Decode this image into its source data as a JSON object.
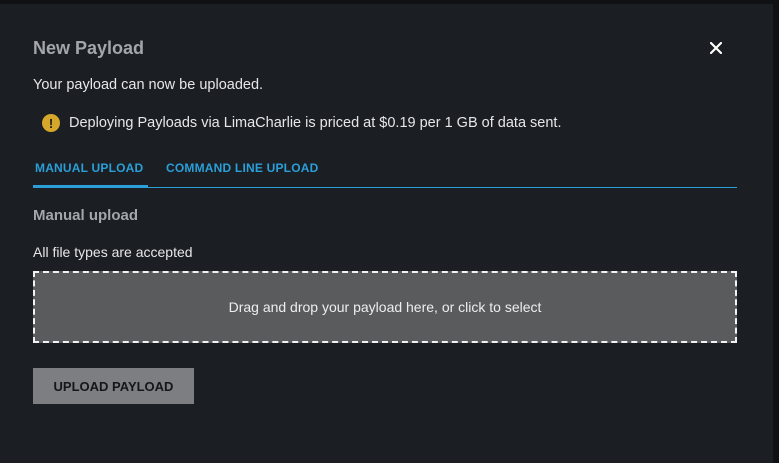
{
  "modal": {
    "title": "New Payload",
    "close_icon": "close-icon",
    "subtitle": "Your payload can now be uploaded.",
    "notice": {
      "icon": "warning-icon",
      "icon_glyph": "!",
      "text": "Deploying Payloads via LimaCharlie is priced at $0.19 per 1 GB of data sent."
    },
    "tabs": [
      {
        "label": "MANUAL UPLOAD",
        "active": true
      },
      {
        "label": "COMMAND LINE UPLOAD",
        "active": false
      }
    ],
    "section_title": "Manual upload",
    "accepted_text": "All file types are accepted",
    "dropzone_text": "Drag and drop your payload here, or click to select",
    "upload_button": "UPLOAD PAYLOAD"
  },
  "colors": {
    "accent": "#2a9fd8",
    "warning": "#d5a72a",
    "background": "#1b1e22"
  }
}
